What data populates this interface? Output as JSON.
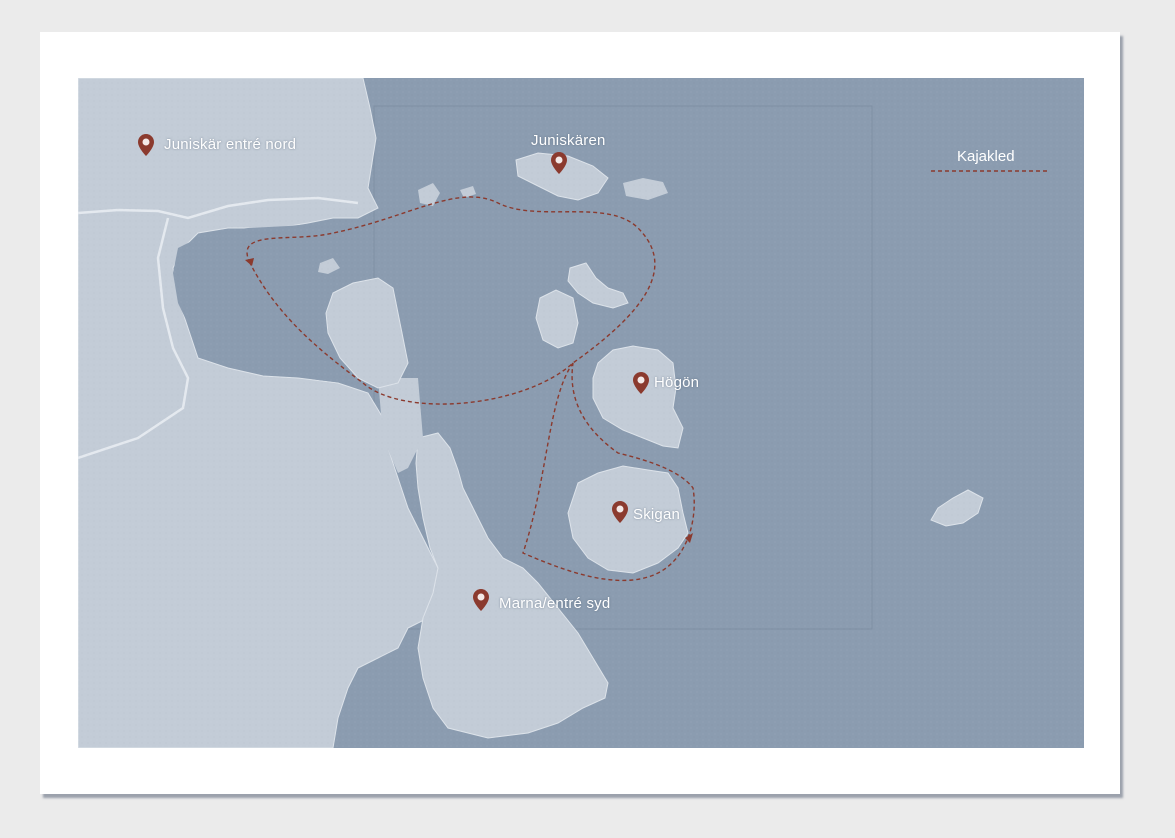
{
  "map": {
    "water_color": "#8b9cb0",
    "land_color": "#c2cbd6",
    "route_color": "#8b3a2e",
    "pin_color": "#8b3a2e"
  },
  "places": [
    {
      "id": "juniskar-entre-nord",
      "label": "Juniskär entré nord",
      "icon": "location-pin-icon"
    },
    {
      "id": "juniskaren",
      "label": "Juniskären",
      "icon": "location-pin-icon"
    },
    {
      "id": "hogon",
      "label": "Högön",
      "icon": "location-pin-icon"
    },
    {
      "id": "skigan",
      "label": "Skigan",
      "icon": "location-pin-icon"
    },
    {
      "id": "marna-entre-syd",
      "label": "Marna/entré syd",
      "icon": "location-pin-icon"
    }
  ],
  "legend": {
    "label": "Kajakled",
    "line_style": "dashed"
  }
}
